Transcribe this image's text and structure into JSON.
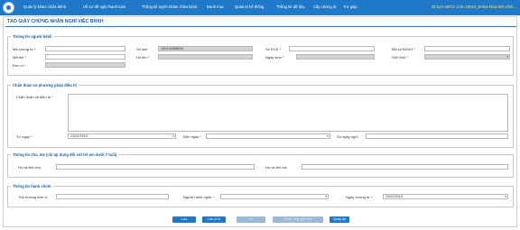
{
  "nav": {
    "items": [
      "Quản lý khám chữa bệnh",
      "Hồ sơ đề nghị thanh toán",
      "Thống kê tuyến khám chữa bệnh",
      "Danh mục",
      "Quản trị hệ thống",
      "Thống kê dữ liệu",
      "Cấp chứng từ",
      "Trợ giúp"
    ],
    "user_info": "ID:12A-28/Cơ chức 19010_BVĐa khoa tỉnh Vĩnh..."
  },
  "page": {
    "title": "TẠO GIẤY CHỨNG NHẬN NGHỈ VIỆC BHXH"
  },
  "patient": {
    "legend": "Thông tin người bệnh",
    "ma_chung_tu_label": "Mã chứng từ",
    "so_seri_label": "Số seri",
    "so_seri_value": "100101856634",
    "so_kcb_label": "Số KCB",
    "ma_so_bhxh_label": "Mã số BHXH",
    "ma_the_label": "Mã thẻ",
    "ho_ten_label": "Họ tên",
    "ngay_sinh_label": "Ngày sinh",
    "gioi_tinh_label": "Giới tính",
    "don_vi_label": "Đơn vị"
  },
  "diagnosis": {
    "legend": "Chẩn đoán và phương pháp điều trị",
    "chan_doan_label": "Chẩn đoán và điều trị",
    "tu_ngay_label": "Từ ngày",
    "tu_ngay_value": "23/02/2019",
    "den_ngay_label": "Đến ngày",
    "so_ngay_nghi_label": "Số ngày nghỉ"
  },
  "parents": {
    "legend": "Thông tin cha, mẹ (chỉ áp dụng đối với trẻ em dưới 7 tuổi)",
    "cha_label": "Họ và tên cha",
    "me_label": "Họ và tên mẹ"
  },
  "admin": {
    "legend": "Thông tin hành chính",
    "thu_truong_label": "Thủ trưởng đơn vị",
    "nguoi_hanh_nghe_label": "Người hành nghề",
    "ngay_chung_tu_label": "Ngày chứng từ",
    "ngay_chung_tu_value": "23/02/2019"
  },
  "buttons": {
    "save": "Lưu",
    "save_print": "Lưu & In",
    "print": "In",
    "delete": "Chấm hủy gửi chứ",
    "back": "Quay lại"
  },
  "colors": {
    "nav_bg": "#1f78c8",
    "accent": "#1f5fa8",
    "required": "#dd0000",
    "user_info": "#ffe65c"
  }
}
